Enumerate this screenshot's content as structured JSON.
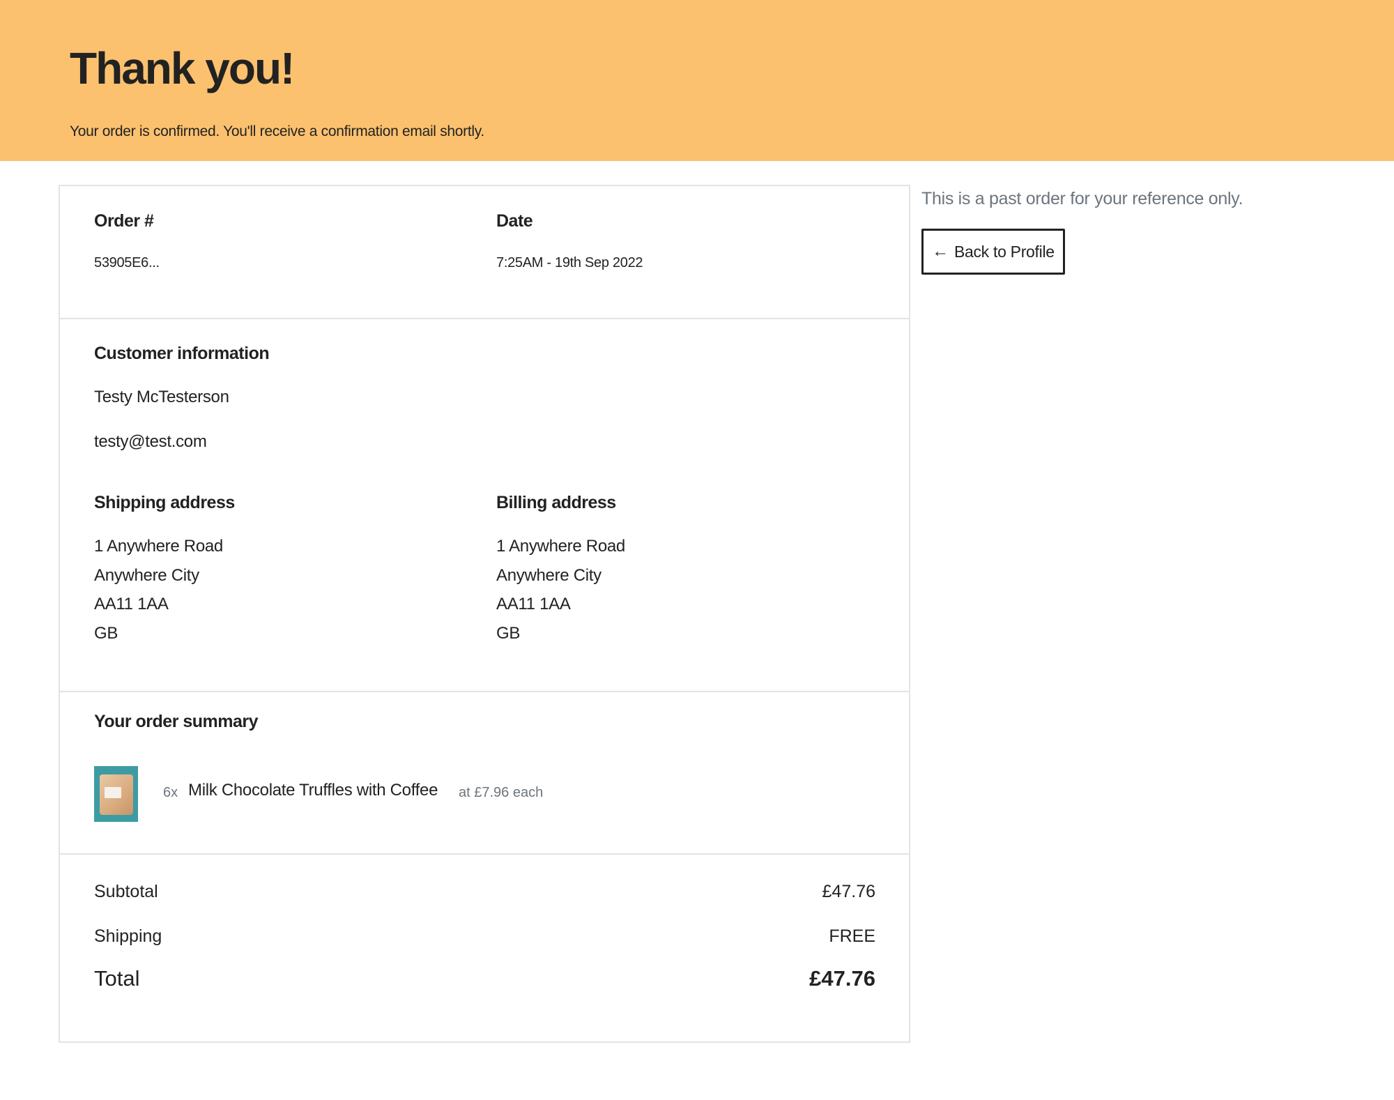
{
  "hero": {
    "title": "Thank you!",
    "subtitle": "Your order is confirmed. You'll receive a confirmation email shortly."
  },
  "order": {
    "number_label": "Order #",
    "number_value": "53905E6...",
    "date_label": "Date",
    "date_value": "7:25AM - 19th Sep 2022"
  },
  "customer": {
    "heading": "Customer information",
    "name": "Testy McTesterson",
    "email": "testy@test.com"
  },
  "shipping": {
    "heading": "Shipping address",
    "lines": [
      "1 Anywhere Road",
      "Anywhere City",
      "AA11 1AA",
      "GB"
    ]
  },
  "billing": {
    "heading": "Billing address",
    "lines": [
      "1 Anywhere Road",
      "Anywhere City",
      "AA11 1AA",
      "GB"
    ]
  },
  "summary": {
    "heading": "Your order summary",
    "items": [
      {
        "quantity": "6x",
        "name": "Milk Chocolate Truffles with Coffee",
        "each_price": "at £7.96 each",
        "image_icon": "truffle-bag-thumbnail"
      }
    ]
  },
  "totals": {
    "subtotal_label": "Subtotal",
    "subtotal_value": "£47.76",
    "shipping_label": "Shipping",
    "shipping_value": "FREE",
    "total_label": "Total",
    "total_value": "£47.76"
  },
  "sidebar": {
    "note": "This is a past order for your reference only.",
    "back_button_label": "Back to Profile",
    "back_button_icon": "arrow-left-icon"
  },
  "colors": {
    "hero_background": "#fbc16e",
    "muted_text": "#6c757d",
    "border": "#e3e3e3",
    "thumbnail_background": "#3d9ba3"
  }
}
